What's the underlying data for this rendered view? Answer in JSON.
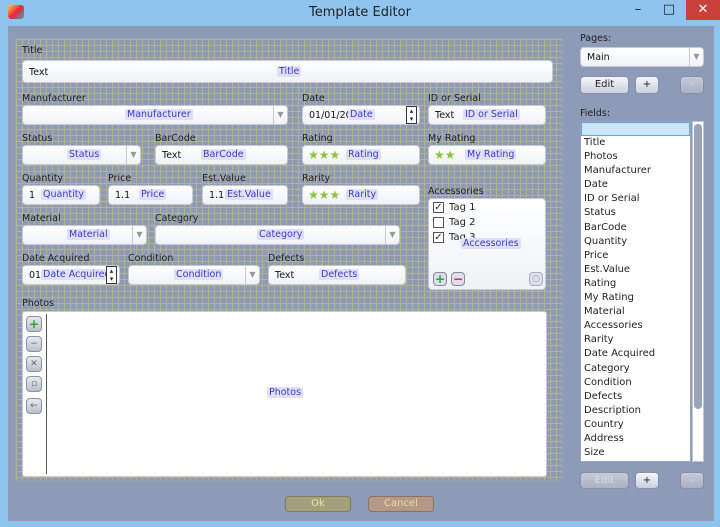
{
  "window": {
    "title": "Template Editor",
    "minimize": "–",
    "maximize": "□",
    "close": "✕"
  },
  "form": {
    "title": {
      "label": "Title",
      "value": "Text",
      "tag": "Title"
    },
    "manufacturer": {
      "label": "Manufacturer",
      "tag": "Manufacturer"
    },
    "date": {
      "label": "Date",
      "value": "01/01/200",
      "tag": "Date"
    },
    "id_serial": {
      "label": "ID or Serial",
      "value": "Text",
      "tag": "ID or Serial"
    },
    "status": {
      "label": "Status",
      "tag": "Status"
    },
    "barcode": {
      "label": "BarCode",
      "value": "Text",
      "tag": "BarCode"
    },
    "rating": {
      "label": "Rating",
      "stars": "★★★",
      "tag": "Rating",
      "value": 3
    },
    "my_rating": {
      "label": "My Rating",
      "stars": "★★",
      "tag": "My Rating",
      "value": 2
    },
    "quantity": {
      "label": "Quantity",
      "value": "1",
      "tag": "Quantity"
    },
    "price": {
      "label": "Price",
      "value": "1.1",
      "tag": "Price"
    },
    "est_value": {
      "label": "Est.Value",
      "value": "1.1",
      "tag": "Est.Value"
    },
    "rarity": {
      "label": "Rarity",
      "stars": "★★★",
      "tag": "Rarity",
      "value": 3
    },
    "accessories": {
      "label": "Accessories",
      "tag": "Accessories",
      "items": [
        {
          "label": "Tag 1",
          "checked": true
        },
        {
          "label": "Tag 2",
          "checked": false
        },
        {
          "label": "Tag 3",
          "checked": true
        }
      ]
    },
    "material": {
      "label": "Material",
      "tag": "Material"
    },
    "category": {
      "label": "Category",
      "tag": "Category"
    },
    "date_acquired": {
      "label": "Date Acquired",
      "value": "01/",
      "tag": "Date Acquired"
    },
    "condition": {
      "label": "Condition",
      "tag": "Condition"
    },
    "defects": {
      "label": "Defects",
      "value": "Text",
      "tag": "Defects"
    },
    "photos": {
      "label": "Photos",
      "tag": "Photos"
    }
  },
  "buttons": {
    "ok": "Ok",
    "cancel": "Cancel"
  },
  "sidebar": {
    "pages_label": "Pages:",
    "pages_selected": "Main",
    "edit": "Edit",
    "plus": "+",
    "minus": "-",
    "fields_label": "Fields:",
    "fields": [
      "Title",
      "Photos",
      "Manufacturer",
      "Date",
      "ID or Serial",
      "Status",
      "BarCode",
      "Quantity",
      "Price",
      "Est.Value",
      "Rating",
      "My Rating",
      "Material",
      "Accessories",
      "Rarity",
      "Date Acquired",
      "Category",
      "Condition",
      "Defects",
      "Description",
      "Country",
      "Address",
      "Size"
    ]
  }
}
